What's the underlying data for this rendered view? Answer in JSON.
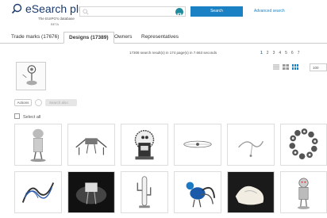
{
  "header": {
    "logo_title": "eSearch plus",
    "logo_subtitle": "The EUIPO's database",
    "logo_version": "BETA",
    "search_placeholder": "",
    "search_button": "Search",
    "advanced_link": "Advanced search"
  },
  "tabs": [
    {
      "label": "Trade marks (17676)",
      "active": false
    },
    {
      "label": "Designs (17389)",
      "active": true
    },
    {
      "label": "Owners",
      "active": false
    },
    {
      "label": "Representatives",
      "active": false
    }
  ],
  "results": {
    "summary": "17308 search result(s) in 174 page(s) in 7.663 seconds",
    "pages": [
      "1",
      "2",
      "3",
      "4",
      "5",
      "6",
      "7"
    ],
    "current_page": "1",
    "per_page": "100"
  },
  "toolbar": {
    "actions_label": "Actions",
    "search_also_label": "Search also"
  },
  "select_all_label": "Select all",
  "colors": {
    "accent": "#1a82c4",
    "brand": "#1a3a6b",
    "camera": "#1e8a9e"
  },
  "thumbnails": [
    {
      "name": "figure-with-bowl"
    },
    {
      "name": "bench-rack"
    },
    {
      "name": "spiky-robot"
    },
    {
      "name": "wire-clip"
    },
    {
      "name": "twisted-wire"
    },
    {
      "name": "ring-of-beads"
    },
    {
      "name": "spiral-coil"
    },
    {
      "name": "dark-stand"
    },
    {
      "name": "cactus-lamp"
    },
    {
      "name": "peacock-figure"
    },
    {
      "name": "white-sculpture"
    },
    {
      "name": "robot-figure"
    }
  ]
}
